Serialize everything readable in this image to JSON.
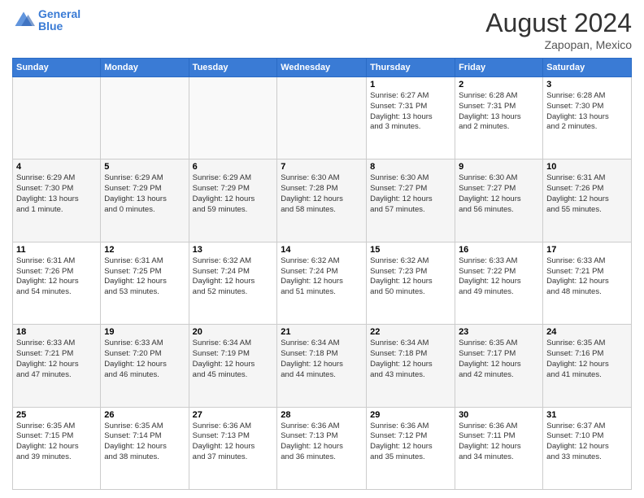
{
  "header": {
    "logo_line1": "General",
    "logo_line2": "Blue",
    "month_title": "August 2024",
    "subtitle": "Zapopan, Mexico"
  },
  "weekdays": [
    "Sunday",
    "Monday",
    "Tuesday",
    "Wednesday",
    "Thursday",
    "Friday",
    "Saturday"
  ],
  "weeks": [
    [
      {
        "day": "",
        "info": ""
      },
      {
        "day": "",
        "info": ""
      },
      {
        "day": "",
        "info": ""
      },
      {
        "day": "",
        "info": ""
      },
      {
        "day": "1",
        "info": "Sunrise: 6:27 AM\nSunset: 7:31 PM\nDaylight: 13 hours\nand 3 minutes."
      },
      {
        "day": "2",
        "info": "Sunrise: 6:28 AM\nSunset: 7:31 PM\nDaylight: 13 hours\nand 2 minutes."
      },
      {
        "day": "3",
        "info": "Sunrise: 6:28 AM\nSunset: 7:30 PM\nDaylight: 13 hours\nand 2 minutes."
      }
    ],
    [
      {
        "day": "4",
        "info": "Sunrise: 6:29 AM\nSunset: 7:30 PM\nDaylight: 13 hours\nand 1 minute."
      },
      {
        "day": "5",
        "info": "Sunrise: 6:29 AM\nSunset: 7:29 PM\nDaylight: 13 hours\nand 0 minutes."
      },
      {
        "day": "6",
        "info": "Sunrise: 6:29 AM\nSunset: 7:29 PM\nDaylight: 12 hours\nand 59 minutes."
      },
      {
        "day": "7",
        "info": "Sunrise: 6:30 AM\nSunset: 7:28 PM\nDaylight: 12 hours\nand 58 minutes."
      },
      {
        "day": "8",
        "info": "Sunrise: 6:30 AM\nSunset: 7:27 PM\nDaylight: 12 hours\nand 57 minutes."
      },
      {
        "day": "9",
        "info": "Sunrise: 6:30 AM\nSunset: 7:27 PM\nDaylight: 12 hours\nand 56 minutes."
      },
      {
        "day": "10",
        "info": "Sunrise: 6:31 AM\nSunset: 7:26 PM\nDaylight: 12 hours\nand 55 minutes."
      }
    ],
    [
      {
        "day": "11",
        "info": "Sunrise: 6:31 AM\nSunset: 7:26 PM\nDaylight: 12 hours\nand 54 minutes."
      },
      {
        "day": "12",
        "info": "Sunrise: 6:31 AM\nSunset: 7:25 PM\nDaylight: 12 hours\nand 53 minutes."
      },
      {
        "day": "13",
        "info": "Sunrise: 6:32 AM\nSunset: 7:24 PM\nDaylight: 12 hours\nand 52 minutes."
      },
      {
        "day": "14",
        "info": "Sunrise: 6:32 AM\nSunset: 7:24 PM\nDaylight: 12 hours\nand 51 minutes."
      },
      {
        "day": "15",
        "info": "Sunrise: 6:32 AM\nSunset: 7:23 PM\nDaylight: 12 hours\nand 50 minutes."
      },
      {
        "day": "16",
        "info": "Sunrise: 6:33 AM\nSunset: 7:22 PM\nDaylight: 12 hours\nand 49 minutes."
      },
      {
        "day": "17",
        "info": "Sunrise: 6:33 AM\nSunset: 7:21 PM\nDaylight: 12 hours\nand 48 minutes."
      }
    ],
    [
      {
        "day": "18",
        "info": "Sunrise: 6:33 AM\nSunset: 7:21 PM\nDaylight: 12 hours\nand 47 minutes."
      },
      {
        "day": "19",
        "info": "Sunrise: 6:33 AM\nSunset: 7:20 PM\nDaylight: 12 hours\nand 46 minutes."
      },
      {
        "day": "20",
        "info": "Sunrise: 6:34 AM\nSunset: 7:19 PM\nDaylight: 12 hours\nand 45 minutes."
      },
      {
        "day": "21",
        "info": "Sunrise: 6:34 AM\nSunset: 7:18 PM\nDaylight: 12 hours\nand 44 minutes."
      },
      {
        "day": "22",
        "info": "Sunrise: 6:34 AM\nSunset: 7:18 PM\nDaylight: 12 hours\nand 43 minutes."
      },
      {
        "day": "23",
        "info": "Sunrise: 6:35 AM\nSunset: 7:17 PM\nDaylight: 12 hours\nand 42 minutes."
      },
      {
        "day": "24",
        "info": "Sunrise: 6:35 AM\nSunset: 7:16 PM\nDaylight: 12 hours\nand 41 minutes."
      }
    ],
    [
      {
        "day": "25",
        "info": "Sunrise: 6:35 AM\nSunset: 7:15 PM\nDaylight: 12 hours\nand 39 minutes."
      },
      {
        "day": "26",
        "info": "Sunrise: 6:35 AM\nSunset: 7:14 PM\nDaylight: 12 hours\nand 38 minutes."
      },
      {
        "day": "27",
        "info": "Sunrise: 6:36 AM\nSunset: 7:13 PM\nDaylight: 12 hours\nand 37 minutes."
      },
      {
        "day": "28",
        "info": "Sunrise: 6:36 AM\nSunset: 7:13 PM\nDaylight: 12 hours\nand 36 minutes."
      },
      {
        "day": "29",
        "info": "Sunrise: 6:36 AM\nSunset: 7:12 PM\nDaylight: 12 hours\nand 35 minutes."
      },
      {
        "day": "30",
        "info": "Sunrise: 6:36 AM\nSunset: 7:11 PM\nDaylight: 12 hours\nand 34 minutes."
      },
      {
        "day": "31",
        "info": "Sunrise: 6:37 AM\nSunset: 7:10 PM\nDaylight: 12 hours\nand 33 minutes."
      }
    ]
  ]
}
